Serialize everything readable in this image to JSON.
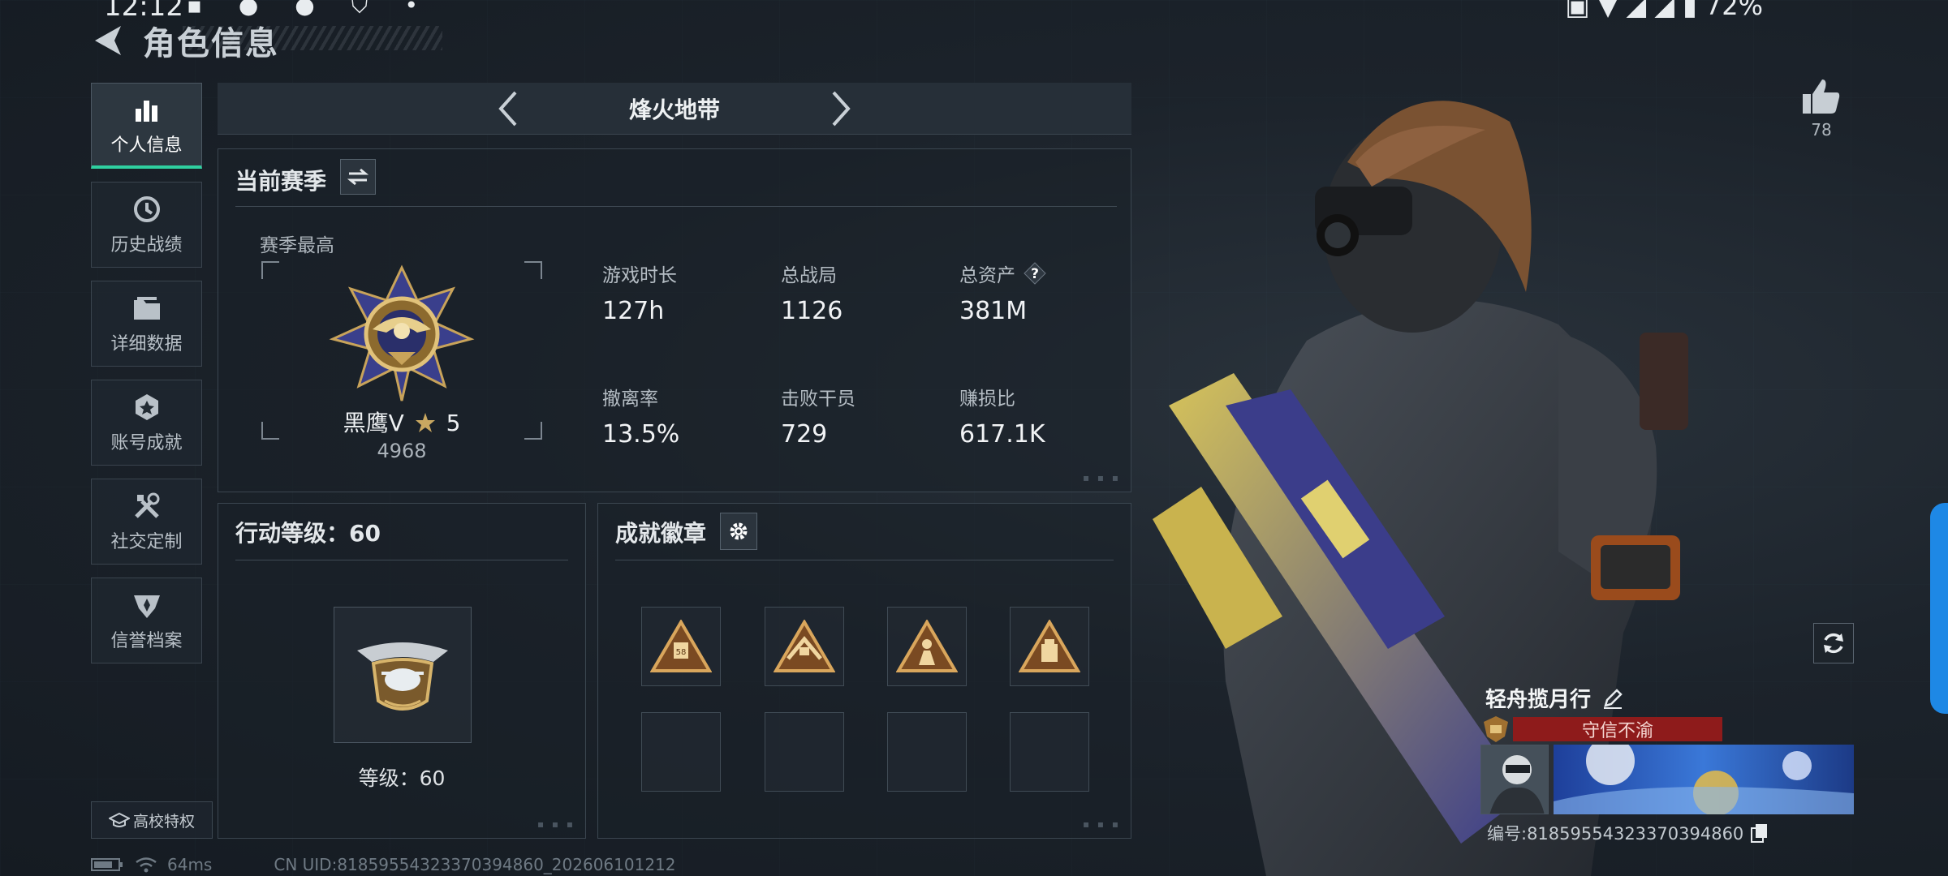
{
  "status_bar": {
    "time": "12:12",
    "battery": "72%"
  },
  "header": {
    "title": "角色信息"
  },
  "nav": {
    "items": [
      {
        "label": "个人信息",
        "icon": "bar-chart-icon",
        "active": true
      },
      {
        "label": "历史战绩",
        "icon": "history-clock-icon",
        "active": false
      },
      {
        "label": "详细数据",
        "icon": "folder-icon",
        "active": false
      },
      {
        "label": "账号成就",
        "icon": "achievement-icon",
        "active": false
      },
      {
        "label": "社交定制",
        "icon": "tools-icon",
        "active": false
      },
      {
        "label": "信誉档案",
        "icon": "shield-emblem-icon",
        "active": false
      }
    ],
    "campus_button": "高校特权"
  },
  "mode": {
    "title": "烽火地带"
  },
  "season": {
    "title": "当前赛季",
    "best_label": "赛季最高",
    "rank_name": "黑鹰V",
    "rank_stars": "5",
    "rank_score": "4968",
    "stats": [
      {
        "label": "游戏时长",
        "value": "127h"
      },
      {
        "label": "总战局",
        "value": "1126"
      },
      {
        "label": "总资产",
        "value": "381M",
        "has_help": true
      },
      {
        "label": "撤离率",
        "value": "13.5%"
      },
      {
        "label": "击败干员",
        "value": "729"
      },
      {
        "label": "赚损比",
        "value": "617.1K"
      }
    ]
  },
  "action_level": {
    "title": "行动等级：60",
    "level_text": "等级：60"
  },
  "achievements": {
    "title": "成就徽章",
    "badges": [
      {
        "filled": true
      },
      {
        "filled": true
      },
      {
        "filled": true
      },
      {
        "filled": true
      },
      {
        "filled": false
      },
      {
        "filled": false
      },
      {
        "filled": false
      },
      {
        "filled": false
      }
    ]
  },
  "footer": {
    "ping": "64ms",
    "uid_text": "CN UID:81859554323370394860_202606101212"
  },
  "profile": {
    "likes": "78",
    "player_name": "轻舟揽月行",
    "trust_label": "守信不渝",
    "player_id": "编号:81859554323370394860"
  },
  "colors": {
    "accent": "#2fd0a0",
    "trust_red": "#8e1b1b",
    "edge_tab": "#1e88e5"
  }
}
